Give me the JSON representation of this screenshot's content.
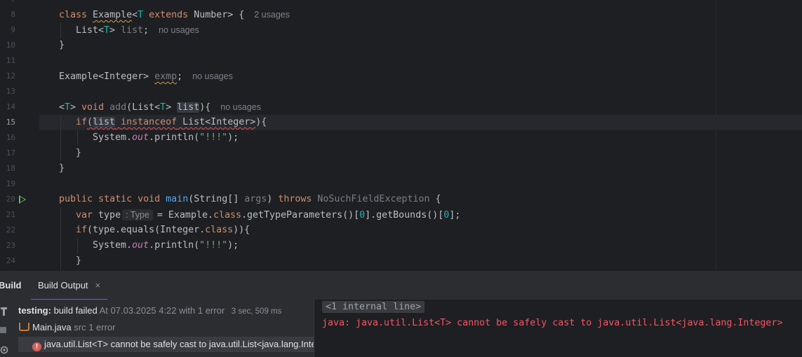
{
  "editor": {
    "gutter": [
      "7",
      "8",
      "9",
      "10",
      "11",
      "12",
      "13",
      "14",
      "15",
      "16",
      "17",
      "18",
      "19",
      "20",
      "21",
      "22",
      "23",
      "24"
    ],
    "current_line": "15",
    "hints": {
      "usages_2": "2 usages",
      "no_usages": "no usages",
      "type_inlay": ": Type"
    },
    "tokens": {
      "class_kw": "class",
      "example": "Example",
      "lt": "<",
      "T": "T",
      "extends_kw": "extends",
      "number_gt_brace": " Number> {",
      "list_lt": "List<",
      "gt_sp": "> ",
      "list_field": "list",
      "semi": ";",
      "brace_close": "}",
      "example_integer": "Example<Integer> ",
      "exmp": "exmp",
      "void_kw": "void",
      "add_fn": "add",
      "add_open": "(List<",
      "list_param": "list",
      "add_close": "){",
      "if_kw": "if",
      "paren_open": "(",
      "instanceof_kw": "instanceof",
      "list_integer": "List<Integer>",
      "paren_brace": "){",
      "system": "System.",
      "out": "out",
      "println_open": ".println(",
      "str_bang": "\"!!!\"",
      "close_semi": ");",
      "public_kw": "public",
      "static_kw": "static",
      "main_fn": "main",
      "main_params": "(String[] ",
      "args": "args",
      "throws_kw": "throws",
      "nsfe": "NoSuchFieldException",
      "open_brace": " {",
      "var_kw": "var",
      "type_var": "type",
      "eq_example": "= Example.",
      "class_lit": "class",
      "get_type_params": ".getTypeParameters()[",
      "zero": "0",
      "get_bounds": "].getBounds()[",
      "close_bracket_semi": "];",
      "type_equals": "(type.equals(Integer.",
      "close_paren_brace": ")){"
    }
  },
  "tool_window": {
    "title": "Build",
    "tab_label": "Build Output",
    "tab_close": "×"
  },
  "build_tree": {
    "root_name": "testing:",
    "root_status": "build failed",
    "root_time": "At 07.03.2025 4:22 with 1 error",
    "root_duration": "3 sec, 509 ms",
    "file_name": "Main.java",
    "file_meta": "src 1 error",
    "error_text": "java.util.List<T> cannot be safely cast to java.util.List<java.lang.Integer>"
  },
  "console": {
    "internal_line": "<1 internal line>",
    "error_message": "java: java.util.List<T> cannot be safely cast to java.util.List<java.lang.Integer>"
  },
  "icons": {
    "run": "run-gutter-icon",
    "error": "error-badge-icon",
    "java_file": "java-file-icon",
    "hammer": "hammer-icon",
    "stop": "stop-icon",
    "settings": "gear-icon"
  },
  "colors": {
    "keyword": "#cf8e6d",
    "type_param": "#16baac",
    "error_red": "#f75464",
    "accent_blue": "#3574f0",
    "run_green": "#5fb865"
  }
}
